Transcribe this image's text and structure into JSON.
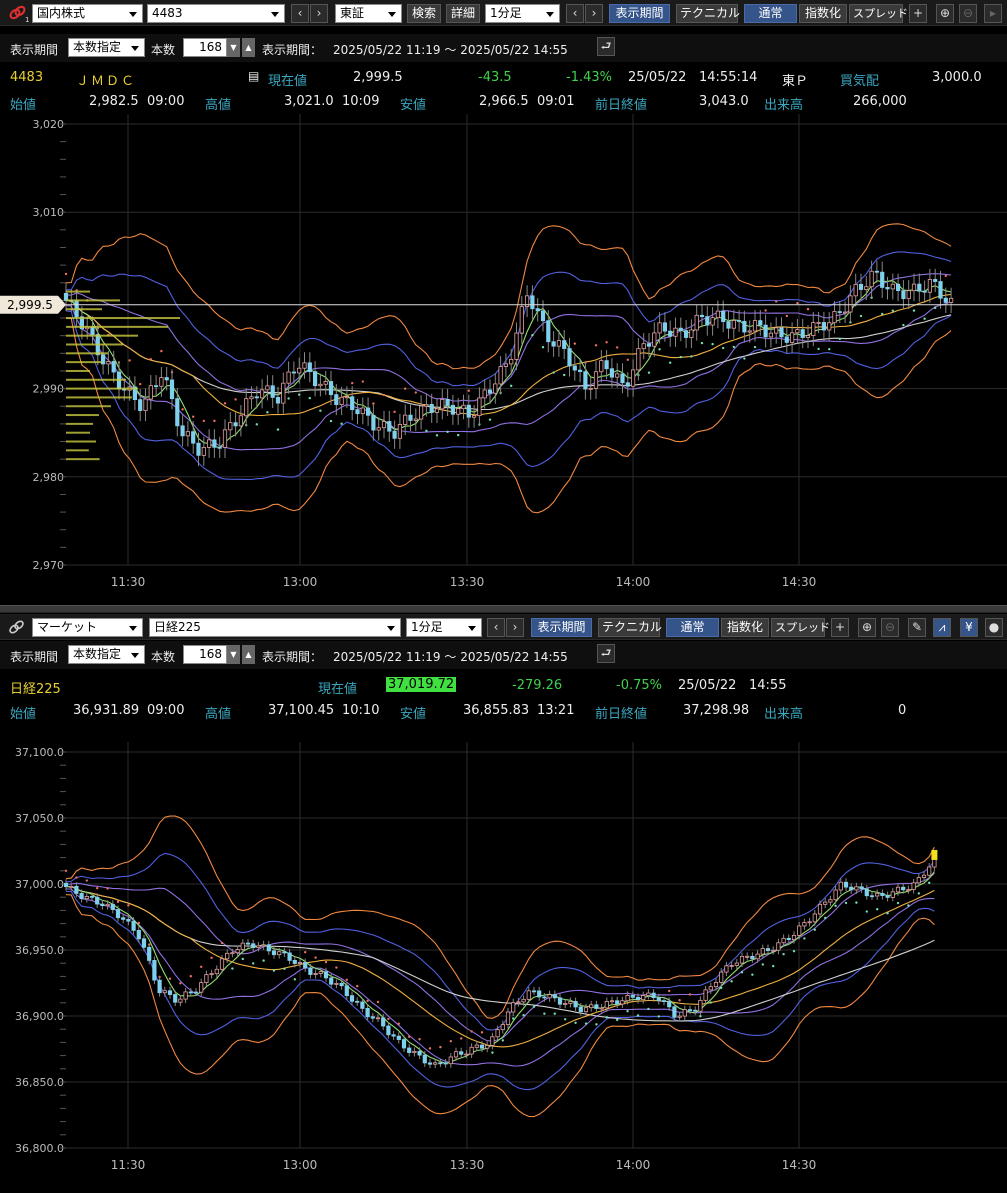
{
  "panel1": {
    "toolbar": {
      "market": "国内株式",
      "code": "4483",
      "exchange": "東証",
      "search": "検索",
      "detail": "詳細",
      "interval": "1分足",
      "period": "表示期間",
      "technical": "テクニカル",
      "normal": "通常",
      "index": "指数化",
      "spread": "スプレッド",
      "plus": "+"
    },
    "settings": {
      "label_period": "表示期間",
      "mode": "本数指定",
      "label_count": "本数",
      "count": "168",
      "label_period2": "表示期間：",
      "range": "2025/05/22 11:19 ～ 2025/05/22 14:55"
    },
    "info": {
      "code": "4483",
      "name": "ＪＭＤＣ",
      "label_now": "現在値",
      "now": "2,999.5",
      "change": "-43.5",
      "change_pct": "-1.43%",
      "date": "25/05/22",
      "time": "14:55:14",
      "market": "東Ｐ",
      "label_ask": "買気配",
      "ask": "3,000.0",
      "label_open": "始値",
      "open": "2,982.5",
      "open_time": "09:00",
      "label_high": "高値",
      "high": "3,021.0",
      "high_time": "10:09",
      "label_low": "安値",
      "low": "2,966.5",
      "low_time": "09:01",
      "label_prev": "前日終値",
      "prev": "3,043.0",
      "label_vol": "出来高",
      "vol": "266,000"
    },
    "current_tag": "2,999.5"
  },
  "panel2": {
    "toolbar": {
      "market": "マーケット",
      "code": "日経225",
      "interval": "1分足",
      "period": "表示期間",
      "technical": "テクニカル",
      "normal": "通常",
      "index": "指数化",
      "spread": "スプレッド",
      "plus": "+",
      "yen": "¥"
    },
    "settings": {
      "label_period": "表示期間",
      "mode": "本数指定",
      "label_count": "本数",
      "count": "168",
      "label_period2": "表示期間：",
      "range": "2025/05/22 11:19 ～ 2025/05/22 14:55"
    },
    "info": {
      "name": "日経225",
      "label_now": "現在値",
      "now": "37,019.72",
      "change": "-279.26",
      "change_pct": "-0.75%",
      "date": "25/05/22",
      "time": "14:55",
      "label_open": "始値",
      "open": "36,931.89",
      "open_time": "09:00",
      "label_high": "高値",
      "high": "37,100.45",
      "high_time": "10:10",
      "label_low": "安値",
      "low": "36,855.83",
      "low_time": "13:21",
      "label_prev": "前日終値",
      "prev": "37,298.98",
      "label_vol": "出来高",
      "vol": "0"
    }
  },
  "colors": {
    "bull": "#e8a0a0",
    "bear": "#7fd0ec",
    "grid": "#2c2c2c",
    "ma_short": "#90e070",
    "ma_mid": "#f0b040",
    "ma_long": "#d0d0d0",
    "bb1": "#9070e0",
    "bb2": "#5060e0",
    "bb3": "#f08840",
    "psar_up": "#70e0b0",
    "psar_dn": "#f07060",
    "volume_profile": "#c8c840"
  },
  "chart_data": [
    {
      "type": "candlestick",
      "title": "4483 ＪＭＤＣ",
      "ylim": [
        2970,
        3020
      ],
      "y_ticks": [
        "3,020",
        "3,010",
        "2,990",
        "2,980",
        "2,970"
      ],
      "x_ticks": [
        "11:30",
        "13:00",
        "13:30",
        "14:00",
        "14:30"
      ],
      "close_path": [
        3000,
        2997,
        2993,
        2990,
        2988,
        2992,
        2985,
        2983,
        2984,
        2987,
        2990,
        2989,
        2993,
        2991,
        2989,
        2988,
        2986,
        2985,
        2987,
        2988,
        2988,
        2987,
        2990,
        2993,
        3001,
        2996,
        2994,
        2990,
        2993,
        2990,
        2995,
        2997,
        2996,
        2998,
        2998,
        2997,
        2997,
        2996,
        2996,
        2997,
        2998,
        3001,
        3003,
        3001,
        3001,
        3002,
        2999.5
      ]
    },
    {
      "type": "candlestick",
      "title": "日経225",
      "ylim": [
        36800,
        37100
      ],
      "y_ticks": [
        "37,100.0",
        "37,050.0",
        "37,000.0",
        "36,950.0",
        "36,900.0",
        "36,850.0",
        "36,800.0"
      ],
      "x_ticks": [
        "11:30",
        "13:00",
        "13:30",
        "14:00",
        "14:30"
      ],
      "close_path": [
        36998,
        36990,
        36985,
        36975,
        36960,
        36920,
        36912,
        36920,
        36935,
        36950,
        36955,
        36950,
        36945,
        36935,
        36930,
        36920,
        36905,
        36895,
        36880,
        36870,
        36862,
        36870,
        36875,
        36880,
        36905,
        36918,
        36915,
        36910,
        36905,
        36908,
        36912,
        36915,
        36915,
        36900,
        36905,
        36925,
        36940,
        36945,
        36950,
        36958,
        36970,
        36985,
        37000,
        36995,
        36990,
        36995,
        37000,
        37019.72
      ]
    }
  ]
}
